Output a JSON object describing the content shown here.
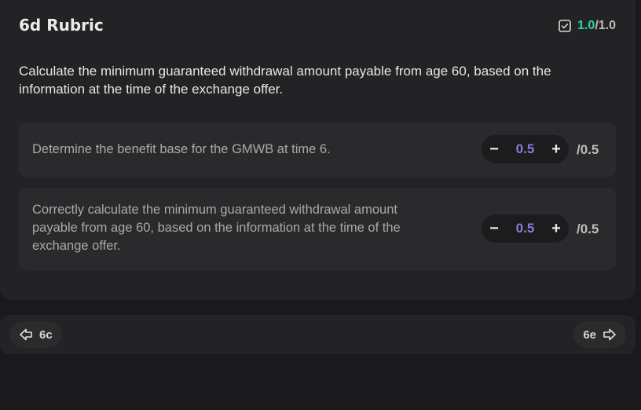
{
  "card": {
    "title": "6d Rubric",
    "score_earned": "1.0",
    "score_total": "/1.0",
    "question": "Calculate the minimum guaranteed withdrawal amount payable from age 60, based on the information at the time of the exchange offer."
  },
  "criteria": [
    {
      "description": "Determine the benefit base for the GMWB at time 6.",
      "minus": "−",
      "value": "0.5",
      "plus": "+",
      "max": "/0.5"
    },
    {
      "description": "Correctly calculate the minimum guaranteed withdrawal amount payable from age 60, based on the information at the time of the exchange offer.",
      "minus": "−",
      "value": "0.5",
      "plus": "+",
      "max": "/0.5"
    }
  ],
  "nav": {
    "prev_label": "6c",
    "next_label": "6e"
  },
  "colors": {
    "accent_score": "#2fd1a0",
    "stepper_value": "#8c7ad6",
    "background": "#1a1a1c",
    "card": "#232325"
  },
  "icons": {
    "score": "checkbox-check-icon",
    "prev": "arrow-left-icon",
    "next": "arrow-right-icon"
  }
}
